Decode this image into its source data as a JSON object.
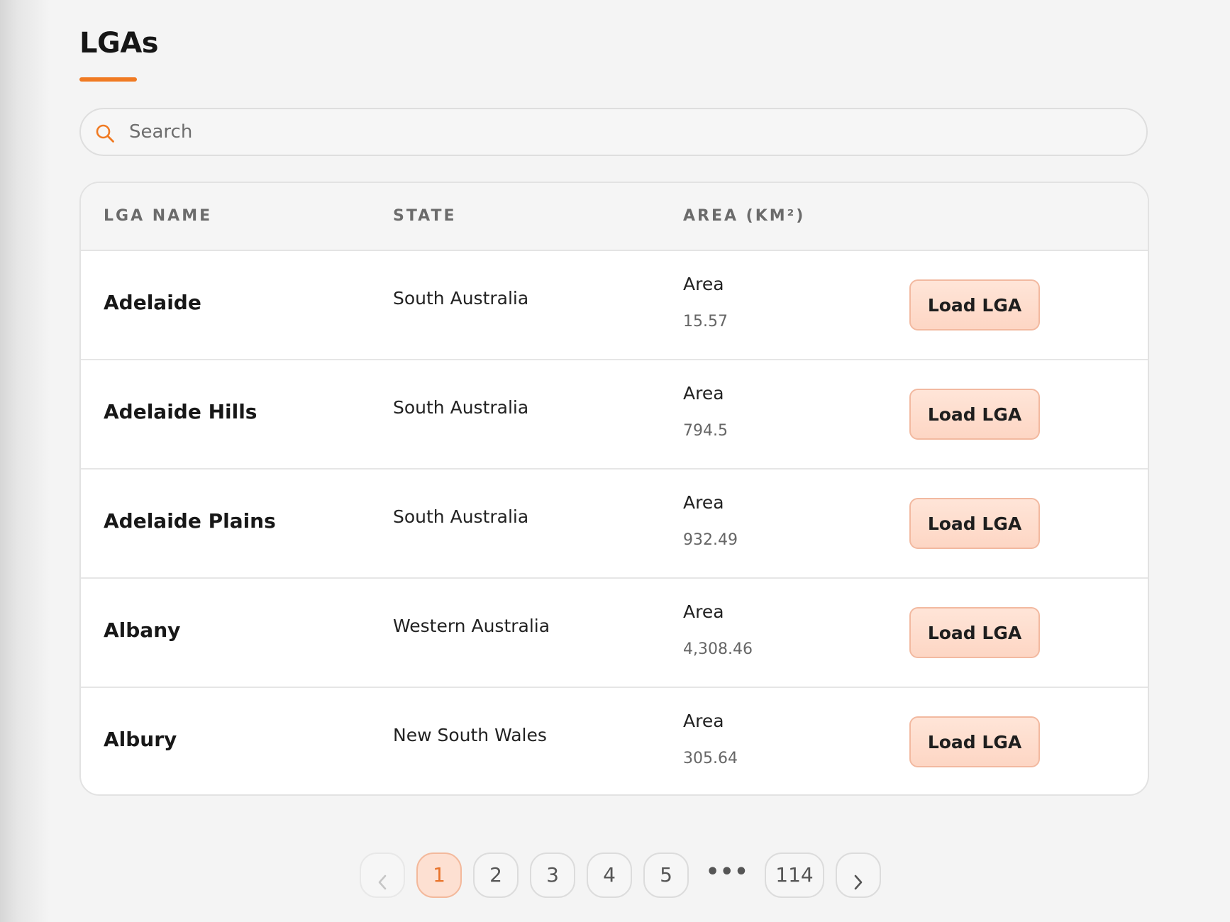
{
  "page": {
    "title": "LGAs"
  },
  "search": {
    "placeholder": "Search",
    "value": ""
  },
  "table": {
    "headers": {
      "name": "LGA NAME",
      "state": "STATE",
      "area": "AREA (KM²)"
    },
    "rows": [
      {
        "name": "Adelaide",
        "state": "South Australia",
        "area_label": "Area",
        "area_value": "15.57",
        "action": "Load LGA"
      },
      {
        "name": "Adelaide Hills",
        "state": "South Australia",
        "area_label": "Area",
        "area_value": "794.5",
        "action": "Load LGA"
      },
      {
        "name": "Adelaide Plains",
        "state": "South Australia",
        "area_label": "Area",
        "area_value": "932.49",
        "action": "Load LGA"
      },
      {
        "name": "Albany",
        "state": "Western Australia",
        "area_label": "Area",
        "area_value": "4,308.46",
        "action": "Load LGA"
      },
      {
        "name": "Albury",
        "state": "New South Wales",
        "area_label": "Area",
        "area_value": "305.64",
        "action": "Load LGA"
      }
    ]
  },
  "pagination": {
    "pages": [
      "1",
      "2",
      "3",
      "4",
      "5"
    ],
    "ellipsis": "•••",
    "last_page": "114",
    "current_page": "1",
    "prev_icon": "chevron-left-icon",
    "next_icon": "chevron-right-icon"
  },
  "colors": {
    "accent": "#f07a22",
    "button_bg": "#fde0d2",
    "background": "#f4f4f4"
  }
}
